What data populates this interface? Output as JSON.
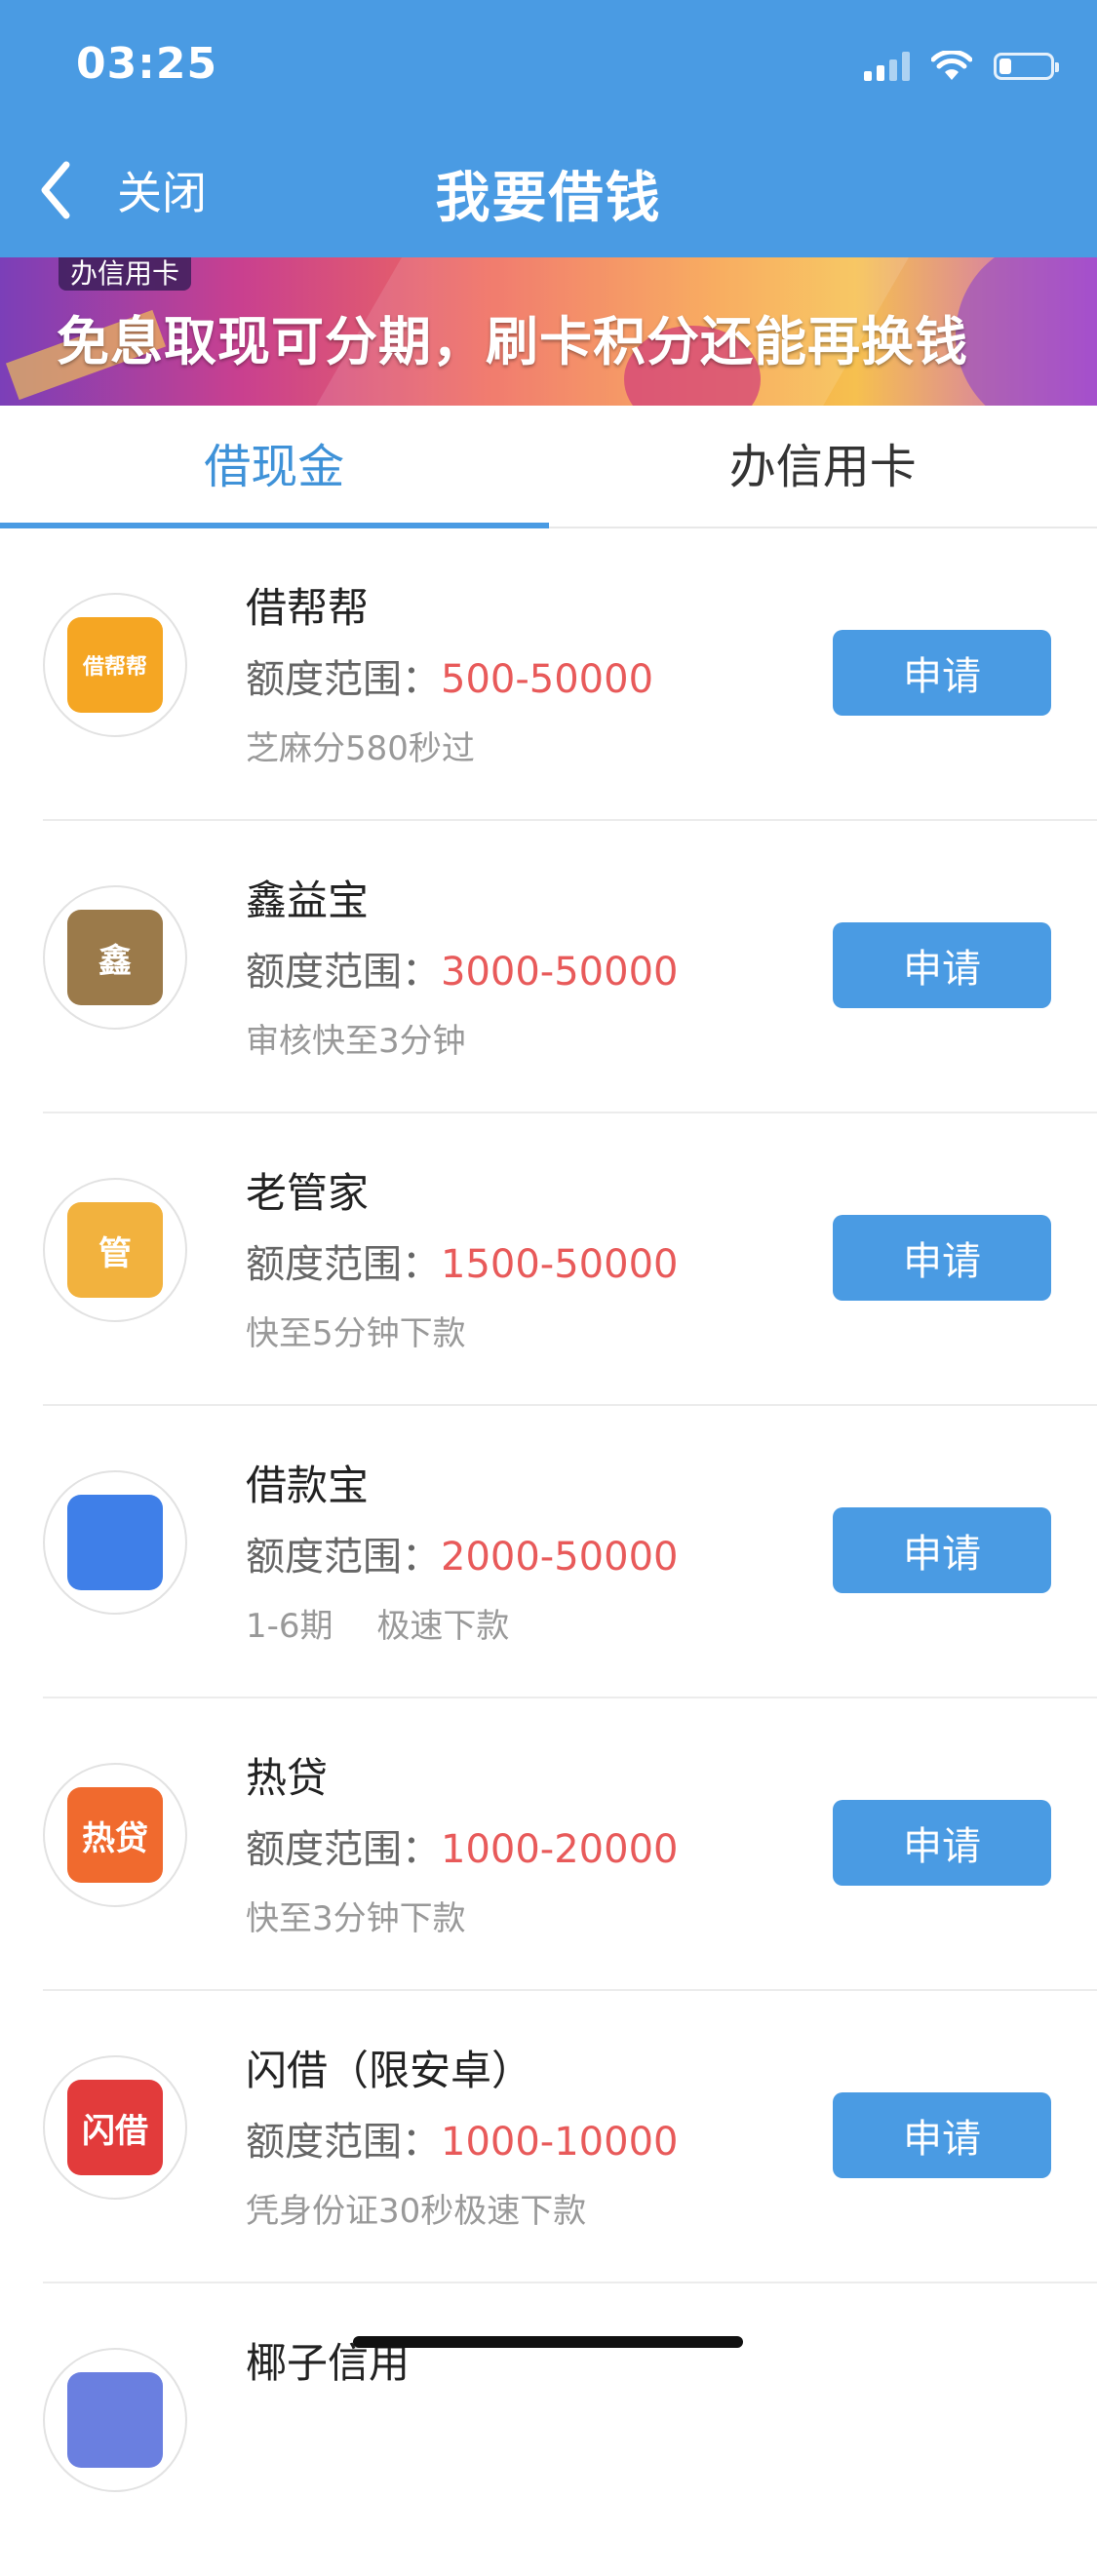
{
  "status_bar": {
    "time": "03:25"
  },
  "nav": {
    "close_label": "关闭",
    "title": "我要借钱"
  },
  "banner": {
    "tag": "办信用卡",
    "headline": "免息取现可分期，刷卡积分还能再换钱"
  },
  "tabs": [
    {
      "label": "借现金",
      "active": true
    },
    {
      "label": "办信用卡",
      "active": false
    }
  ],
  "range_label": "额度范围：",
  "items": [
    {
      "name": "借帮帮",
      "amount": "500-50000",
      "desc": "芝麻分580秒过",
      "logo_text": "借帮帮",
      "logo_color": "#F5A623",
      "button": "申请"
    },
    {
      "name": "鑫益宝",
      "amount": "3000-50000",
      "desc": "审核快至3分钟",
      "logo_text": "鑫",
      "logo_color": "#9B7A4A",
      "button": "申请"
    },
    {
      "name": "老管家",
      "amount": "1500-50000",
      "desc": "快至5分钟下款",
      "logo_text": "管",
      "logo_color": "#F2B23E",
      "button": "申请"
    },
    {
      "name": "借款宝",
      "amount": "2000-50000",
      "desc": "1-6期　 极速下款",
      "logo_text": "",
      "logo_color": "#3F7FE8",
      "button": "申请"
    },
    {
      "name": "热贷",
      "amount": "1000-20000",
      "desc": "快至3分钟下款",
      "logo_text": "热贷",
      "logo_color": "#F06A2E",
      "button": "申请"
    },
    {
      "name": "闪借（限安卓）",
      "amount": "1000-10000",
      "desc": "凭身份证30秒极速下款",
      "logo_text": "闪借",
      "logo_color": "#E23B3B",
      "button": "申请"
    }
  ],
  "partial_item": {
    "name": "椰子信用"
  },
  "colors": {
    "primary": "#4A9BE3",
    "amount": "#E85A5A"
  }
}
